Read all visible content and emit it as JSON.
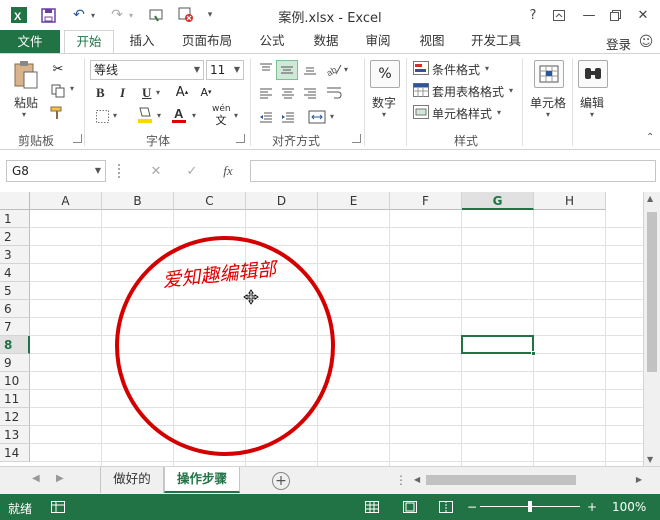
{
  "window": {
    "title": "案例.xlsx - Excel",
    "help": "?",
    "minimize": "—",
    "close": "✕"
  },
  "qat": {
    "save_icon": "save-icon",
    "undo_icon": "undo-icon",
    "redo_icon": "redo-icon"
  },
  "tabs": [
    "文件",
    "开始",
    "插入",
    "页面布局",
    "公式",
    "数据",
    "审阅",
    "视图",
    "开发工具"
  ],
  "active_tab": "开始",
  "login": "登录",
  "ribbon": {
    "clipboard": {
      "paste_label": "粘贴",
      "group_label": "剪贴板"
    },
    "font": {
      "font_name": "等线",
      "font_size": "11",
      "group_label": "字体",
      "bold": "B",
      "italic": "I",
      "underline": "U",
      "font_color": "A",
      "phonetic": "wén"
    },
    "alignment": {
      "group_label": "对齐方式"
    },
    "number": {
      "label": "数字",
      "icon": "%"
    },
    "styles": {
      "conditional": "条件格式",
      "table": "套用表格格式",
      "cell_styles": "单元格样式",
      "group_label": "样式"
    },
    "cells": {
      "label": "单元格"
    },
    "editing": {
      "label": "编辑"
    }
  },
  "formula_bar": {
    "name_box": "G8",
    "cancel": "✕",
    "enter": "✓",
    "fx": "fx",
    "formula": ""
  },
  "grid": {
    "columns": [
      "A",
      "B",
      "C",
      "D",
      "E",
      "F",
      "G",
      "H"
    ],
    "rows": [
      "1",
      "2",
      "3",
      "4",
      "5",
      "6",
      "7",
      "8",
      "9",
      "10",
      "11",
      "12",
      "13",
      "14"
    ],
    "selected_cell": "G8",
    "selected_column": "G",
    "selected_row": "8"
  },
  "stamp": {
    "text": "爱知趣编辑部",
    "color": "#e00000"
  },
  "sheets": [
    "做好的",
    "操作步骤"
  ],
  "active_sheet": "操作步骤",
  "status": {
    "ready": "就绪",
    "zoom": "100%"
  },
  "colors": {
    "accent": "#217346",
    "stamp": "#d40000"
  }
}
